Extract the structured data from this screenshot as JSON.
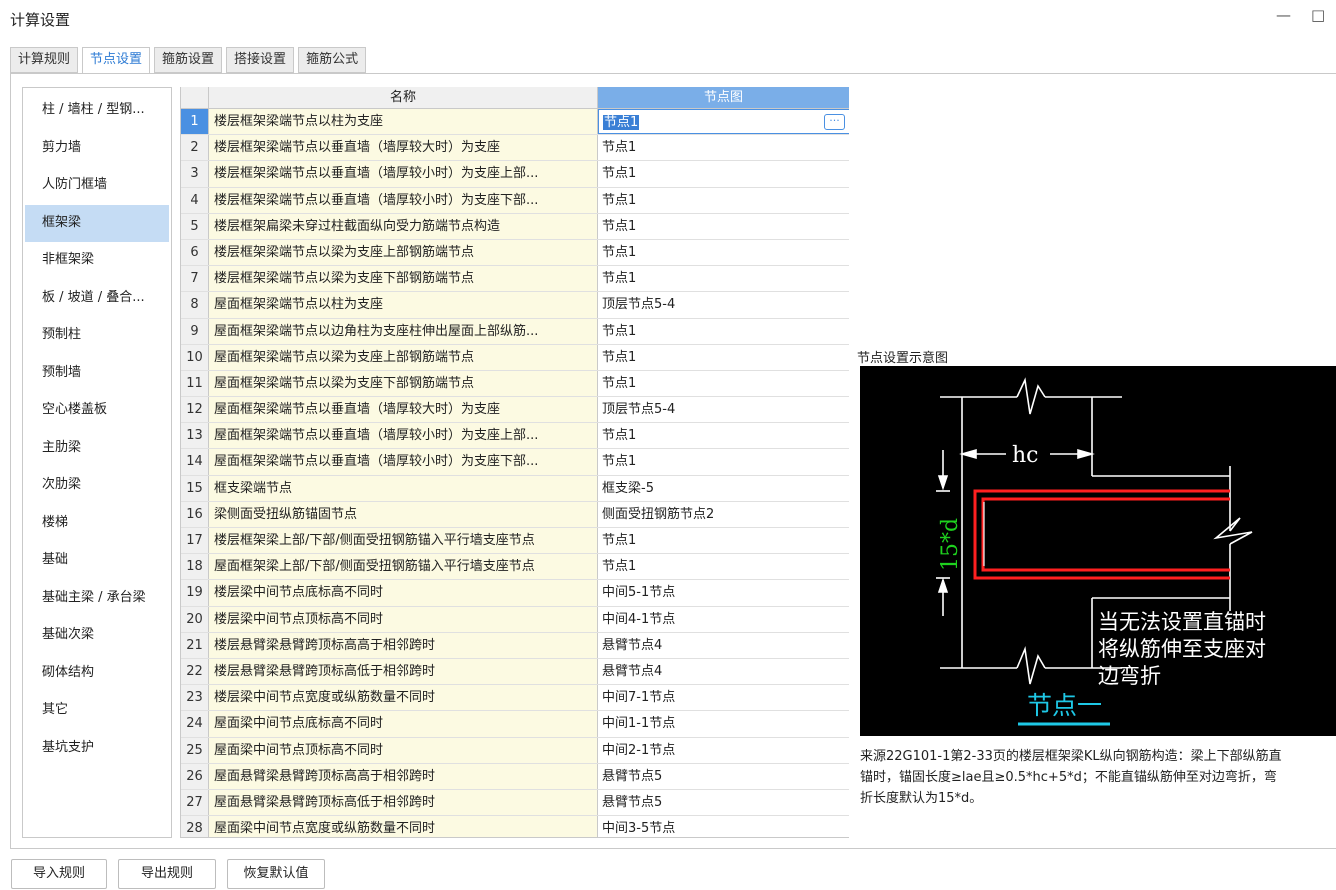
{
  "window": {
    "title": "计算设置",
    "minimize_symbol": "—",
    "maximize_symbol": "□"
  },
  "tabs": [
    {
      "label": "计算规则",
      "active": false
    },
    {
      "label": "节点设置",
      "active": true
    },
    {
      "label": "箍筋设置",
      "active": false
    },
    {
      "label": "搭接设置",
      "active": false
    },
    {
      "label": "箍筋公式",
      "active": false
    }
  ],
  "sidebar": {
    "items": [
      "柱 / 墙柱 / 型钢...",
      "剪力墙",
      "人防门框墙",
      "框架梁",
      "非框架梁",
      "板 / 坡道 / 叠合...",
      "预制柱",
      "预制墙",
      "空心楼盖板",
      "主肋梁",
      "次肋梁",
      "楼梯",
      "基础",
      "基础主梁 / 承台梁",
      "基础次梁",
      "砌体结构",
      "其它",
      "基坑支护"
    ],
    "active_index": 3
  },
  "grid": {
    "headers": {
      "name": "名称",
      "node": "节点图"
    },
    "selected_row": 0,
    "rows": [
      {
        "num": "1",
        "name": "楼层框架梁端节点以柱为支座",
        "node": "节点1"
      },
      {
        "num": "2",
        "name": "楼层框架梁端节点以垂直墙（墙厚较大时）为支座",
        "node": "节点1"
      },
      {
        "num": "3",
        "name": "楼层框架梁端节点以垂直墙（墙厚较小时）为支座上部...",
        "node": "节点1"
      },
      {
        "num": "4",
        "name": "楼层框架梁端节点以垂直墙（墙厚较小时）为支座下部...",
        "node": "节点1"
      },
      {
        "num": "5",
        "name": "楼层框架扁梁未穿过柱截面纵向受力筋端节点构造",
        "node": "节点1"
      },
      {
        "num": "6",
        "name": "楼层框架梁端节点以梁为支座上部钢筋端节点",
        "node": "节点1"
      },
      {
        "num": "7",
        "name": "楼层框架梁端节点以梁为支座下部钢筋端节点",
        "node": "节点1"
      },
      {
        "num": "8",
        "name": "屋面框架梁端节点以柱为支座",
        "node": "顶层节点5-4"
      },
      {
        "num": "9",
        "name": "屋面框架梁端节点以边角柱为支座柱伸出屋面上部纵筋...",
        "node": "节点1"
      },
      {
        "num": "10",
        "name": "屋面框架梁端节点以梁为支座上部钢筋端节点",
        "node": "节点1"
      },
      {
        "num": "11",
        "name": "屋面框架梁端节点以梁为支座下部钢筋端节点",
        "node": "节点1"
      },
      {
        "num": "12",
        "name": "屋面框架梁端节点以垂直墙（墙厚较大时）为支座",
        "node": "顶层节点5-4"
      },
      {
        "num": "13",
        "name": "屋面框架梁端节点以垂直墙（墙厚较小时）为支座上部...",
        "node": "节点1"
      },
      {
        "num": "14",
        "name": "屋面框架梁端节点以垂直墙（墙厚较小时）为支座下部...",
        "node": "节点1"
      },
      {
        "num": "15",
        "name": "框支梁端节点",
        "node": "框支梁-5"
      },
      {
        "num": "16",
        "name": "梁侧面受扭纵筋锚固节点",
        "node": "侧面受扭钢筋节点2"
      },
      {
        "num": "17",
        "name": "楼层框架梁上部/下部/侧面受扭钢筋锚入平行墙支座节点",
        "node": "节点1"
      },
      {
        "num": "18",
        "name": "屋面框架梁上部/下部/侧面受扭钢筋锚入平行墙支座节点",
        "node": "节点1"
      },
      {
        "num": "19",
        "name": "楼层梁中间节点底标高不同时",
        "node": "中间5-1节点"
      },
      {
        "num": "20",
        "name": "楼层梁中间节点顶标高不同时",
        "node": "中间4-1节点"
      },
      {
        "num": "21",
        "name": "楼层悬臂梁悬臂跨顶标高高于相邻跨时",
        "node": "悬臂节点4"
      },
      {
        "num": "22",
        "name": "楼层悬臂梁悬臂跨顶标高低于相邻跨时",
        "node": "悬臂节点4"
      },
      {
        "num": "23",
        "name": "楼层梁中间节点宽度或纵筋数量不同时",
        "node": "中间7-1节点"
      },
      {
        "num": "24",
        "name": "屋面梁中间节点底标高不同时",
        "node": "中间1-1节点"
      },
      {
        "num": "25",
        "name": "屋面梁中间节点顶标高不同时",
        "node": "中间2-1节点"
      },
      {
        "num": "26",
        "name": "屋面悬臂梁悬臂跨顶标高高于相邻跨时",
        "node": "悬臂节点5"
      },
      {
        "num": "27",
        "name": "屋面悬臂梁悬臂跨顶标高低于相邻跨时",
        "node": "悬臂节点5"
      },
      {
        "num": "28",
        "name": "屋面梁中间节点宽度或纵筋数量不同时",
        "node": "中间3-5节点"
      }
    ],
    "ellipsis_label": "···"
  },
  "diagram": {
    "label": "节点设置示意图",
    "hc_label": "hc",
    "dim_label": "15*d",
    "note_lines": [
      "当无法设置直锚时",
      "将纵筋伸至支座对",
      "边弯折"
    ],
    "node_title": "节点一",
    "colors": {
      "background": "#000000",
      "lines": "#ffffff",
      "rebar": "#ff0000",
      "dimension": "#00d000",
      "title": "#00c8e0"
    }
  },
  "description": "来源22G101-1第2-33页的楼层框架梁KL纵向钢筋构造：梁上下部纵筋直\n锚时，锚固长度≥lae且≥0.5*hc+5*d；不能直锚纵筋伸至对边弯折，弯\n折长度默认为15*d。",
  "buttons": {
    "import": "导入规则",
    "export": "导出规则",
    "restore": "恢复默认值"
  }
}
